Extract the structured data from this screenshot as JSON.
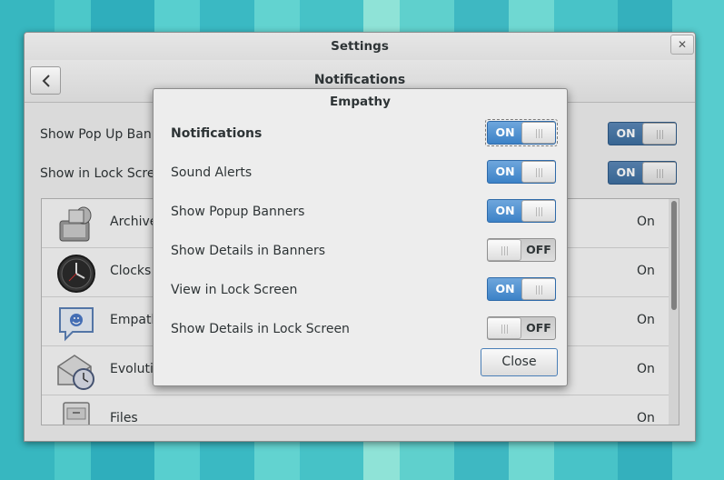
{
  "window": {
    "title": "Settings",
    "close_glyph": "✕",
    "panel_title": "Notifications",
    "global_settings": [
      {
        "label": "Show Pop Up Banners",
        "state": "ON"
      },
      {
        "label": "Show in Lock Screen",
        "state": "ON"
      }
    ],
    "apps": [
      {
        "name": "Archive Manager",
        "status": "On",
        "icon": "archive-icon"
      },
      {
        "name": "Clocks",
        "status": "On",
        "icon": "clock-icon"
      },
      {
        "name": "Empathy",
        "status": "On",
        "icon": "chat-icon"
      },
      {
        "name": "Evolution",
        "status": "On",
        "icon": "mail-clock-icon"
      },
      {
        "name": "Files",
        "status": "On",
        "icon": "file-cabinet-icon"
      }
    ]
  },
  "dialog": {
    "title": "Empathy",
    "options": [
      {
        "label": "Notifications",
        "state": "ON",
        "bold": true
      },
      {
        "label": "Sound Alerts",
        "state": "ON"
      },
      {
        "label": "Show Popup Banners",
        "state": "ON"
      },
      {
        "label": "Show Details in Banners",
        "state": "OFF"
      },
      {
        "label": "View in Lock Screen",
        "state": "ON"
      },
      {
        "label": "Show Details in Lock Screen",
        "state": "OFF"
      }
    ],
    "close_label": "Close"
  },
  "colors": {
    "switch_on": "#4a8ed3",
    "desktop": "#3fc1c4"
  }
}
